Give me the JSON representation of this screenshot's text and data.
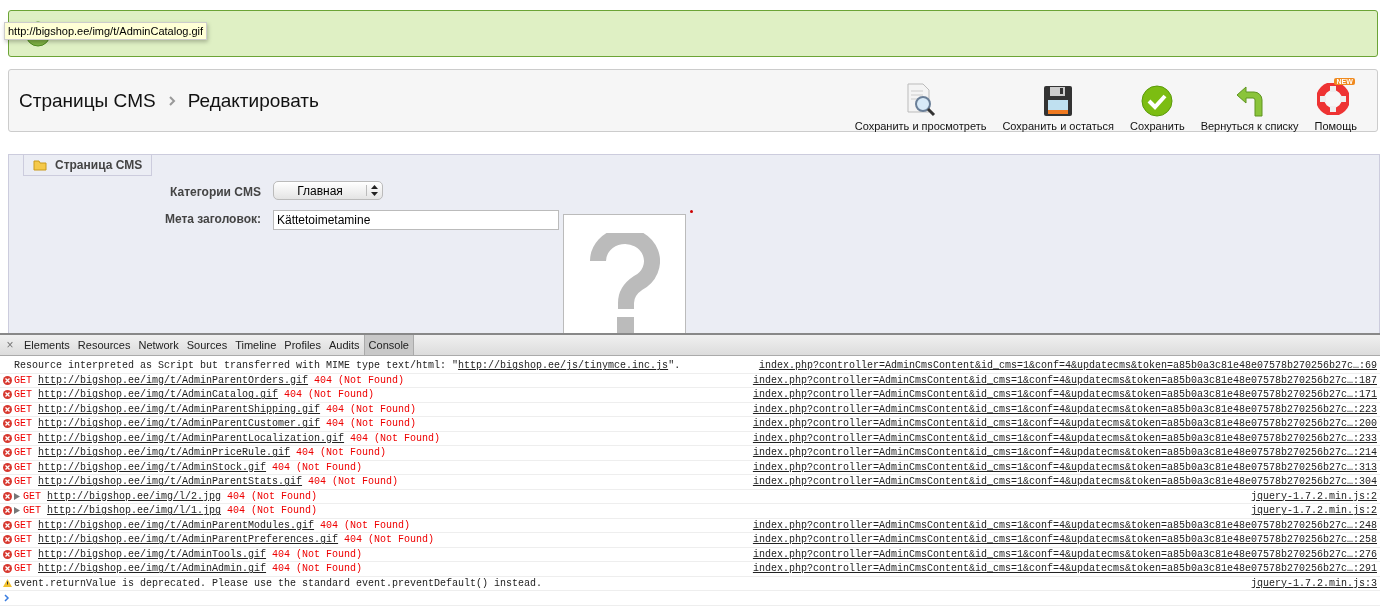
{
  "notice": {
    "tooltip": "http://bigshop.ee/img/t/AdminCatalog.gif"
  },
  "header": {
    "breadcrumb": [
      "Страницы CMS",
      "Редактировать"
    ],
    "toolbar": [
      {
        "kind": "preview",
        "label": "Сохранить и просмотреть"
      },
      {
        "kind": "save-stay",
        "label": "Сохранить и остаться"
      },
      {
        "kind": "save",
        "label": "Сохранить"
      },
      {
        "kind": "back",
        "label": "Вернуться к списку"
      },
      {
        "kind": "help",
        "label": "Помощь",
        "badge": "NEW"
      }
    ]
  },
  "panel": {
    "legend": "Страница CMS",
    "category": {
      "label": "Категории CMS",
      "value": "Главная"
    },
    "meta_title": {
      "label": "Мета заголовок:",
      "value": "Kättetoimetamine"
    }
  },
  "devtools": {
    "close": "×",
    "tabs": [
      {
        "label": "Elements",
        "selected": false
      },
      {
        "label": "Resources",
        "selected": false
      },
      {
        "label": "Network",
        "selected": false
      },
      {
        "label": "Sources",
        "selected": false
      },
      {
        "label": "Timeline",
        "selected": false
      },
      {
        "label": "Profiles",
        "selected": false
      },
      {
        "label": "Audits",
        "selected": false
      },
      {
        "label": "Console",
        "selected": true
      }
    ],
    "messages": [
      {
        "kind": "info",
        "text": "Resource interpreted as Script but transferred with MIME type text/html: \"",
        "url": "http://bigshop.ee/js/tinymce.inc.js",
        "text_after": "\".",
        "source": "index.php?controller=AdminCmsContent&id_cms=1&conf=4&updatecms&token=a85b0a3c81e48e07578b270256b27c…:69"
      },
      {
        "kind": "error",
        "expandable": false,
        "method": "GET",
        "url": "http://bigshop.ee/img/t/AdminParentOrders.gif",
        "status": "404 (Not Found)",
        "source": "index.php?controller=AdminCmsContent&id_cms=1&conf=4&updatecms&token=a85b0a3c81e48e07578b270256b27c…:187"
      },
      {
        "kind": "error",
        "expandable": false,
        "method": "GET",
        "url": "http://bigshop.ee/img/t/AdminCatalog.gif",
        "status": "404 (Not Found)",
        "source": "index.php?controller=AdminCmsContent&id_cms=1&conf=4&updatecms&token=a85b0a3c81e48e07578b270256b27c…:171"
      },
      {
        "kind": "error",
        "expandable": false,
        "method": "GET",
        "url": "http://bigshop.ee/img/t/AdminParentShipping.gif",
        "status": "404 (Not Found)",
        "source": "index.php?controller=AdminCmsContent&id_cms=1&conf=4&updatecms&token=a85b0a3c81e48e07578b270256b27c…:223"
      },
      {
        "kind": "error",
        "expandable": false,
        "method": "GET",
        "url": "http://bigshop.ee/img/t/AdminParentCustomer.gif",
        "status": "404 (Not Found)",
        "source": "index.php?controller=AdminCmsContent&id_cms=1&conf=4&updatecms&token=a85b0a3c81e48e07578b270256b27c…:200"
      },
      {
        "kind": "error",
        "expandable": false,
        "method": "GET",
        "url": "http://bigshop.ee/img/t/AdminParentLocalization.gif",
        "status": "404 (Not Found)",
        "source": "index.php?controller=AdminCmsContent&id_cms=1&conf=4&updatecms&token=a85b0a3c81e48e07578b270256b27c…:233"
      },
      {
        "kind": "error",
        "expandable": false,
        "method": "GET",
        "url": "http://bigshop.ee/img/t/AdminPriceRule.gif",
        "status": "404 (Not Found)",
        "source": "index.php?controller=AdminCmsContent&id_cms=1&conf=4&updatecms&token=a85b0a3c81e48e07578b270256b27c…:214"
      },
      {
        "kind": "error",
        "expandable": false,
        "method": "GET",
        "url": "http://bigshop.ee/img/t/AdminStock.gif",
        "status": "404 (Not Found)",
        "source": "index.php?controller=AdminCmsContent&id_cms=1&conf=4&updatecms&token=a85b0a3c81e48e07578b270256b27c…:313"
      },
      {
        "kind": "error",
        "expandable": false,
        "method": "GET",
        "url": "http://bigshop.ee/img/t/AdminParentStats.gif",
        "status": "404 (Not Found)",
        "source": "index.php?controller=AdminCmsContent&id_cms=1&conf=4&updatecms&token=a85b0a3c81e48e07578b270256b27c…:304"
      },
      {
        "kind": "error",
        "expandable": true,
        "method": "GET",
        "url": "http://bigshop.ee/img/l/2.jpg",
        "status": "404 (Not Found)",
        "source": "jquery-1.7.2.min.js:2"
      },
      {
        "kind": "error",
        "expandable": true,
        "method": "GET",
        "url": "http://bigshop.ee/img/l/1.jpg",
        "status": "404 (Not Found)",
        "source": "jquery-1.7.2.min.js:2"
      },
      {
        "kind": "error",
        "expandable": false,
        "method": "GET",
        "url": "http://bigshop.ee/img/t/AdminParentModules.gif",
        "status": "404 (Not Found)",
        "source": "index.php?controller=AdminCmsContent&id_cms=1&conf=4&updatecms&token=a85b0a3c81e48e07578b270256b27c…:248"
      },
      {
        "kind": "error",
        "expandable": false,
        "method": "GET",
        "url": "http://bigshop.ee/img/t/AdminParentPreferences.gif",
        "status": "404 (Not Found)",
        "source": "index.php?controller=AdminCmsContent&id_cms=1&conf=4&updatecms&token=a85b0a3c81e48e07578b270256b27c…:258"
      },
      {
        "kind": "error",
        "expandable": false,
        "method": "GET",
        "url": "http://bigshop.ee/img/t/AdminTools.gif",
        "status": "404 (Not Found)",
        "source": "index.php?controller=AdminCmsContent&id_cms=1&conf=4&updatecms&token=a85b0a3c81e48e07578b270256b27c…:276"
      },
      {
        "kind": "error",
        "expandable": false,
        "method": "GET",
        "url": "http://bigshop.ee/img/t/AdminAdmin.gif",
        "status": "404 (Not Found)",
        "source": "index.php?controller=AdminCmsContent&id_cms=1&conf=4&updatecms&token=a85b0a3c81e48e07578b270256b27c…:291"
      },
      {
        "kind": "warning",
        "text": "event.returnValue is deprecated. Please use the standard event.preventDefault() instead.",
        "source": "jquery-1.7.2.min.js:3"
      }
    ]
  }
}
